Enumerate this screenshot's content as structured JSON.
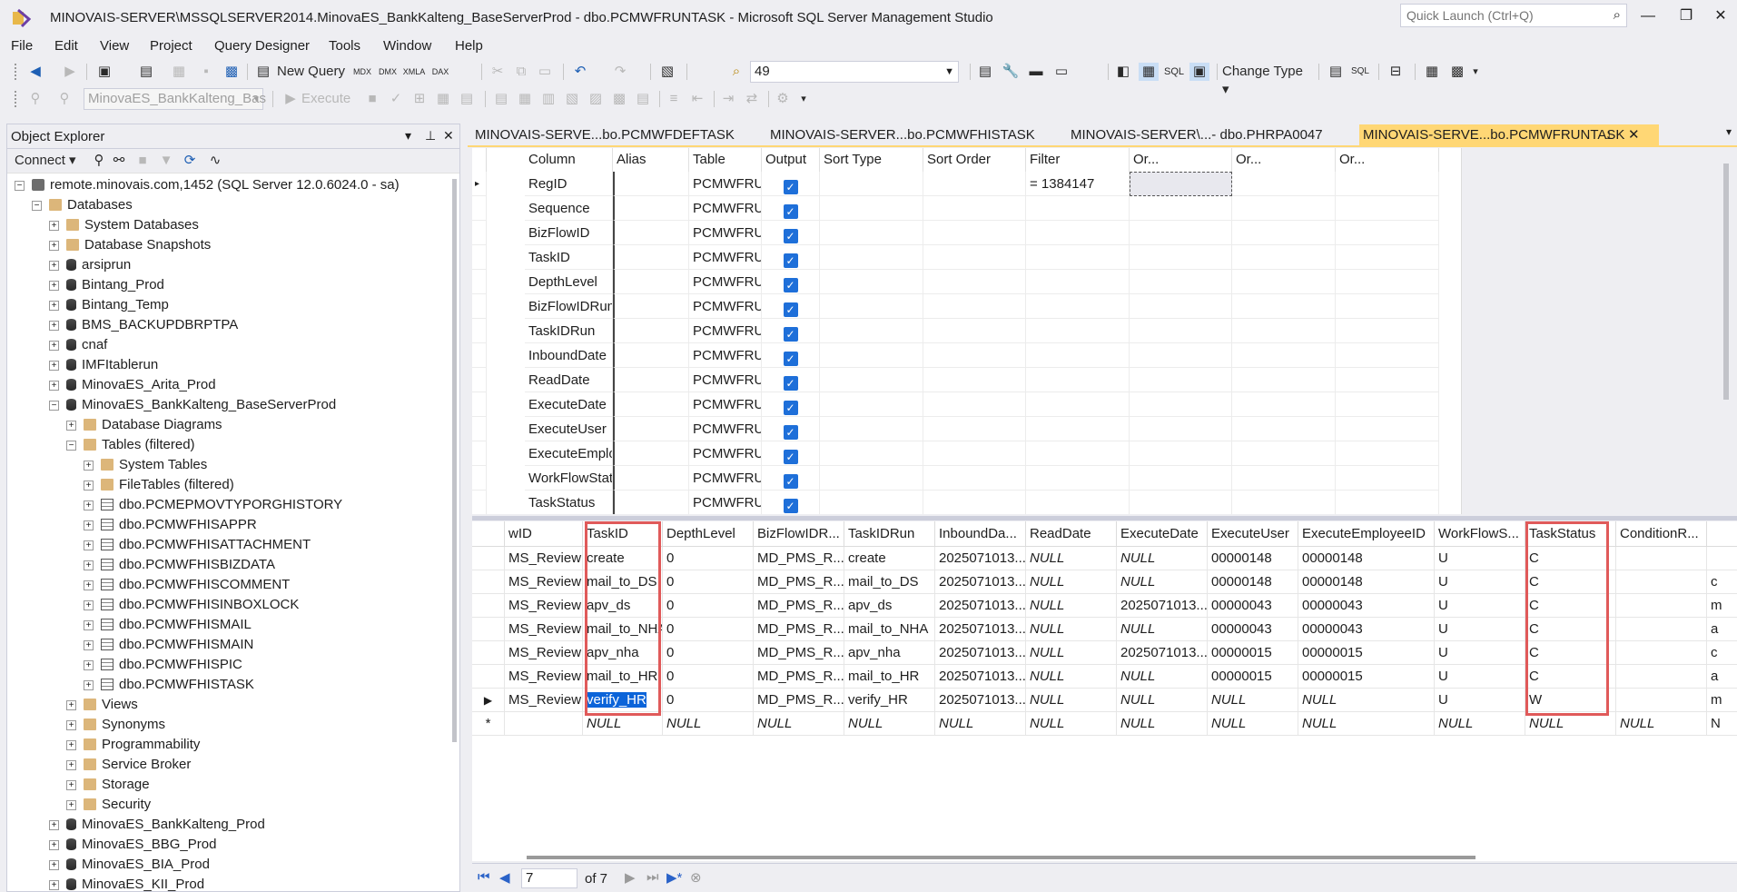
{
  "title_bar": {
    "title": "MINOVAIS-SERVER\\MSSQLSERVER2014.MinovaES_BankKalteng_BaseServerProd - dbo.PCMWFRUNTASK - Microsoft SQL Server Management Studio",
    "quick_launch_placeholder": "Quick Launch (Ctrl+Q)"
  },
  "menu": [
    "File",
    "Edit",
    "View",
    "Project",
    "Query Designer",
    "Tools",
    "Window",
    "Help"
  ],
  "toolbar": {
    "new_query": "New Query",
    "mdx": "MDX",
    "dmx": "DMX",
    "xmla": "XMLA",
    "dax": "DAX",
    "find_value": "49",
    "sql_label": "SQL",
    "change_type": "Change Type",
    "database_combo": "MinovaES_BankKalteng_Bas",
    "execute": "Execute"
  },
  "object_explorer": {
    "title": "Object Explorer",
    "connect": "Connect",
    "tree": [
      {
        "label": "remote.minovais.com,1452 (SQL Server 12.0.6024.0 - sa)",
        "level": 0,
        "icon": "server-icon",
        "exp": "-"
      },
      {
        "label": "Databases",
        "level": 1,
        "icon": "folder-icon",
        "exp": "-"
      },
      {
        "label": "System Databases",
        "level": 2,
        "icon": "folder-icon",
        "exp": "+"
      },
      {
        "label": "Database Snapshots",
        "level": 2,
        "icon": "folder-icon",
        "exp": "+"
      },
      {
        "label": "arsiprun",
        "level": 2,
        "icon": "database-icon",
        "exp": "+"
      },
      {
        "label": "Bintang_Prod",
        "level": 2,
        "icon": "database-icon",
        "exp": "+"
      },
      {
        "label": "Bintang_Temp",
        "level": 2,
        "icon": "database-icon",
        "exp": "+"
      },
      {
        "label": "BMS_BACKUPDBRPTPA",
        "level": 2,
        "icon": "database-icon",
        "exp": "+"
      },
      {
        "label": "cnaf",
        "level": 2,
        "icon": "database-icon",
        "exp": "+"
      },
      {
        "label": "IMFItablerun",
        "level": 2,
        "icon": "database-icon",
        "exp": "+"
      },
      {
        "label": "MinovaES_Arita_Prod",
        "level": 2,
        "icon": "database-icon",
        "exp": "+"
      },
      {
        "label": "MinovaES_BankKalteng_BaseServerProd",
        "level": 2,
        "icon": "database-icon",
        "exp": "-"
      },
      {
        "label": "Database Diagrams",
        "level": 3,
        "icon": "folder-icon",
        "exp": "+"
      },
      {
        "label": "Tables (filtered)",
        "level": 3,
        "icon": "folder-icon",
        "exp": "-"
      },
      {
        "label": "System Tables",
        "level": 4,
        "icon": "folder-icon",
        "exp": "+"
      },
      {
        "label": "FileTables (filtered)",
        "level": 4,
        "icon": "folder-icon",
        "exp": "+"
      },
      {
        "label": "dbo.PCMEPMOVTYPORGHISTORY",
        "level": 4,
        "icon": "table-icon",
        "exp": "+"
      },
      {
        "label": "dbo.PCMWFHISAPPR",
        "level": 4,
        "icon": "table-icon",
        "exp": "+"
      },
      {
        "label": "dbo.PCMWFHISATTACHMENT",
        "level": 4,
        "icon": "table-icon",
        "exp": "+"
      },
      {
        "label": "dbo.PCMWFHISBIZDATA",
        "level": 4,
        "icon": "table-icon",
        "exp": "+"
      },
      {
        "label": "dbo.PCMWFHISCOMMENT",
        "level": 4,
        "icon": "table-icon",
        "exp": "+"
      },
      {
        "label": "dbo.PCMWFHISINBOXLOCK",
        "level": 4,
        "icon": "table-icon",
        "exp": "+"
      },
      {
        "label": "dbo.PCMWFHISMAIL",
        "level": 4,
        "icon": "table-icon",
        "exp": "+"
      },
      {
        "label": "dbo.PCMWFHISMAIN",
        "level": 4,
        "icon": "table-icon",
        "exp": "+"
      },
      {
        "label": "dbo.PCMWFHISPIC",
        "level": 4,
        "icon": "table-icon",
        "exp": "+"
      },
      {
        "label": "dbo.PCMWFHISTASK",
        "level": 4,
        "icon": "table-icon",
        "exp": "+"
      },
      {
        "label": "Views",
        "level": 3,
        "icon": "folder-icon",
        "exp": "+"
      },
      {
        "label": "Synonyms",
        "level": 3,
        "icon": "folder-icon",
        "exp": "+"
      },
      {
        "label": "Programmability",
        "level": 3,
        "icon": "folder-icon",
        "exp": "+"
      },
      {
        "label": "Service Broker",
        "level": 3,
        "icon": "folder-icon",
        "exp": "+"
      },
      {
        "label": "Storage",
        "level": 3,
        "icon": "folder-icon",
        "exp": "+"
      },
      {
        "label": "Security",
        "level": 3,
        "icon": "folder-icon",
        "exp": "+"
      },
      {
        "label": "MinovaES_BankKalteng_Prod",
        "level": 2,
        "icon": "database-icon",
        "exp": "+"
      },
      {
        "label": "MinovaES_BBG_Prod",
        "level": 2,
        "icon": "database-icon",
        "exp": "+"
      },
      {
        "label": "MinovaES_BIA_Prod",
        "level": 2,
        "icon": "database-icon",
        "exp": "+"
      },
      {
        "label": "MinovaES_KII_Prod",
        "level": 2,
        "icon": "database-icon",
        "exp": "+"
      }
    ]
  },
  "doc_tabs": [
    {
      "label": "MINOVAIS-SERVE...bo.PCMWFDEFTASK",
      "active": false
    },
    {
      "label": "MINOVAIS-SERVER...bo.PCMWFHISTASK",
      "active": false
    },
    {
      "label": "MINOVAIS-SERVER\\...- dbo.PHRPA0047",
      "active": false
    },
    {
      "label": "MINOVAIS-SERVE...bo.PCMWFRUNTASK",
      "active": true
    }
  ],
  "criteria": {
    "columns": [
      "Column",
      "Alias",
      "Table",
      "Output",
      "Sort Type",
      "Sort Order",
      "Filter",
      "Or...",
      "Or...",
      "Or..."
    ],
    "rows": [
      {
        "column": "RegID",
        "table": "PCMWFRU...",
        "filter": "= 1384147"
      },
      {
        "column": "Sequence",
        "table": "PCMWFRU...",
        "filter": ""
      },
      {
        "column": "BizFlowID",
        "table": "PCMWFRU...",
        "filter": ""
      },
      {
        "column": "TaskID",
        "table": "PCMWFRU...",
        "filter": ""
      },
      {
        "column": "DepthLevel",
        "table": "PCMWFRU...",
        "filter": ""
      },
      {
        "column": "BizFlowIDRun",
        "table": "PCMWFRU...",
        "filter": ""
      },
      {
        "column": "TaskIDRun",
        "table": "PCMWFRU...",
        "filter": ""
      },
      {
        "column": "InboundDate",
        "table": "PCMWFRU...",
        "filter": ""
      },
      {
        "column": "ReadDate",
        "table": "PCMWFRU...",
        "filter": ""
      },
      {
        "column": "ExecuteDate",
        "table": "PCMWFRU...",
        "filter": ""
      },
      {
        "column": "ExecuteUser",
        "table": "PCMWFRU...",
        "filter": ""
      },
      {
        "column": "ExecuteEmplo...",
        "table": "PCMWFRU...",
        "filter": ""
      },
      {
        "column": "WorkFlowStat...",
        "table": "PCMWFRU...",
        "filter": ""
      },
      {
        "column": "TaskStatus",
        "table": "PCMWFRU...",
        "filter": ""
      }
    ]
  },
  "results": {
    "headers": [
      "wID",
      "TaskID",
      "DepthLevel",
      "BizFlowIDR...",
      "TaskIDRun",
      "InboundDa...",
      "ReadDate",
      "ExecuteDate",
      "ExecuteUser",
      "ExecuteEmployeeID",
      "WorkFlowS...",
      "TaskStatus",
      "ConditionR...",
      ""
    ],
    "rows": [
      [
        "MS_Review",
        "create",
        "0",
        "MD_PMS_R...",
        "create",
        "2025071013...",
        "NULL",
        "NULL",
        "00000148",
        "00000148",
        "U",
        "C",
        "",
        ""
      ],
      [
        "MS_Review",
        "mail_to_DS",
        "0",
        "MD_PMS_R...",
        "mail_to_DS",
        "2025071013...",
        "NULL",
        "NULL",
        "00000148",
        "00000148",
        "U",
        "C",
        "",
        "c"
      ],
      [
        "MS_Review",
        "apv_ds",
        "0",
        "MD_PMS_R...",
        "apv_ds",
        "2025071013...",
        "NULL",
        "2025071013...",
        "00000043",
        "00000043",
        "U",
        "C",
        "",
        "m"
      ],
      [
        "MS_Review",
        "mail_to_NHA",
        "0",
        "MD_PMS_R...",
        "mail_to_NHA",
        "2025071013...",
        "NULL",
        "NULL",
        "00000043",
        "00000043",
        "U",
        "C",
        "",
        "a"
      ],
      [
        "MS_Review",
        "apv_nha",
        "0",
        "MD_PMS_R...",
        "apv_nha",
        "2025071013...",
        "NULL",
        "2025071013...",
        "00000015",
        "00000015",
        "U",
        "C",
        "",
        "c"
      ],
      [
        "MS_Review",
        "mail_to_HR",
        "0",
        "MD_PMS_R...",
        "mail_to_HR",
        "2025071013...",
        "NULL",
        "NULL",
        "00000015",
        "00000015",
        "U",
        "C",
        "",
        "a"
      ],
      [
        "MS_Review",
        "verify_HR",
        "0",
        "MD_PMS_R...",
        "verify_HR",
        "2025071013...",
        "NULL",
        "NULL",
        "NULL",
        "NULL",
        "U",
        "W",
        "",
        "m"
      ],
      [
        "",
        "NULL",
        "NULL",
        "NULL",
        "NULL",
        "NULL",
        "NULL",
        "NULL",
        "NULL",
        "NULL",
        "NULL",
        "NULL",
        "NULL",
        "N"
      ]
    ]
  },
  "navigator": {
    "current": "7",
    "of_label": "of 7"
  }
}
